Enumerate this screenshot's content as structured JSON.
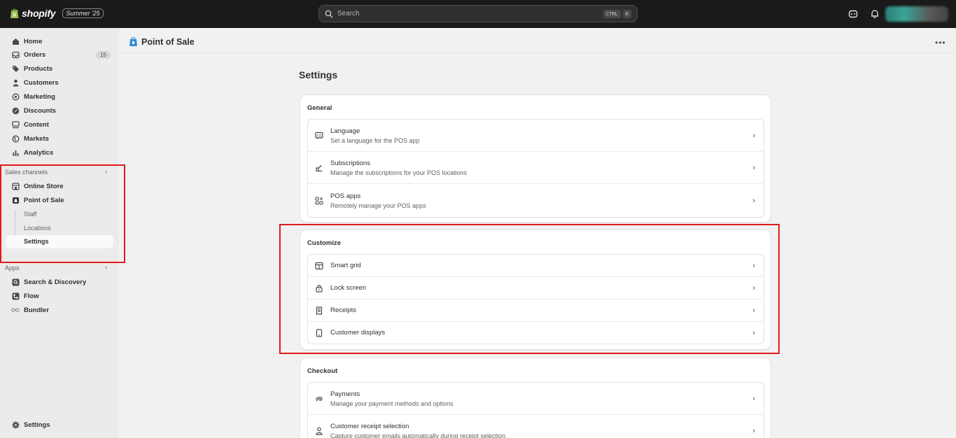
{
  "topbar": {
    "brand": "shopify",
    "edition": "Summer '25",
    "search_placeholder": "Search",
    "shortcut_keys": [
      "CTRL",
      "K"
    ]
  },
  "sidebar": {
    "items": [
      {
        "label": "Home",
        "icon": "home-icon"
      },
      {
        "label": "Orders",
        "icon": "inbox-icon",
        "badge": "15"
      },
      {
        "label": "Products",
        "icon": "tag-icon"
      },
      {
        "label": "Customers",
        "icon": "person-icon"
      },
      {
        "label": "Marketing",
        "icon": "target-icon"
      },
      {
        "label": "Discounts",
        "icon": "discount-icon"
      },
      {
        "label": "Content",
        "icon": "content-icon"
      },
      {
        "label": "Markets",
        "icon": "globe-icon"
      },
      {
        "label": "Analytics",
        "icon": "bar-chart-icon"
      }
    ],
    "sales_channels_label": "Sales channels",
    "channels": [
      {
        "label": "Online Store",
        "icon": "store-icon"
      },
      {
        "label": "Point of Sale",
        "icon": "pos-icon"
      }
    ],
    "pos_sub": [
      "Staff",
      "Locations",
      "Settings"
    ],
    "apps_label": "Apps",
    "apps": [
      {
        "label": "Search & Discovery",
        "icon": "search-discovery-icon"
      },
      {
        "label": "Flow",
        "icon": "flow-icon"
      },
      {
        "label": "Bundler",
        "icon": "bundler-icon"
      }
    ],
    "settings_label": "Settings"
  },
  "page": {
    "title": "Point of Sale",
    "heading": "Settings"
  },
  "general": {
    "title": "General",
    "rows": [
      {
        "title": "Language",
        "desc": "Set a language for the POS app",
        "icon": "language-icon"
      },
      {
        "title": "Subscriptions",
        "desc": "Manage the subscriptions for your POS locations",
        "icon": "subscription-icon"
      },
      {
        "title": "POS apps",
        "desc": "Remotely manage your POS apps",
        "icon": "apps-icon"
      }
    ]
  },
  "customize": {
    "title": "Customize",
    "rows": [
      {
        "title": "Smart grid",
        "icon": "smart-grid-icon"
      },
      {
        "title": "Lock screen",
        "icon": "lock-icon"
      },
      {
        "title": "Receipts",
        "icon": "receipt-icon"
      },
      {
        "title": "Customer displays",
        "icon": "display-icon"
      }
    ]
  },
  "checkout": {
    "title": "Checkout",
    "rows": [
      {
        "title": "Payments",
        "desc": "Manage your payment methods and options",
        "icon": "payment-icon"
      },
      {
        "title": "Customer receipt selection",
        "desc": "Capture customer emails automatically during receipt selection",
        "icon": "customer-receipt-icon"
      }
    ]
  },
  "colors": {
    "topbar": "#1a1a1a",
    "highlight": "#e01b1b",
    "brand": "#95bf47"
  }
}
